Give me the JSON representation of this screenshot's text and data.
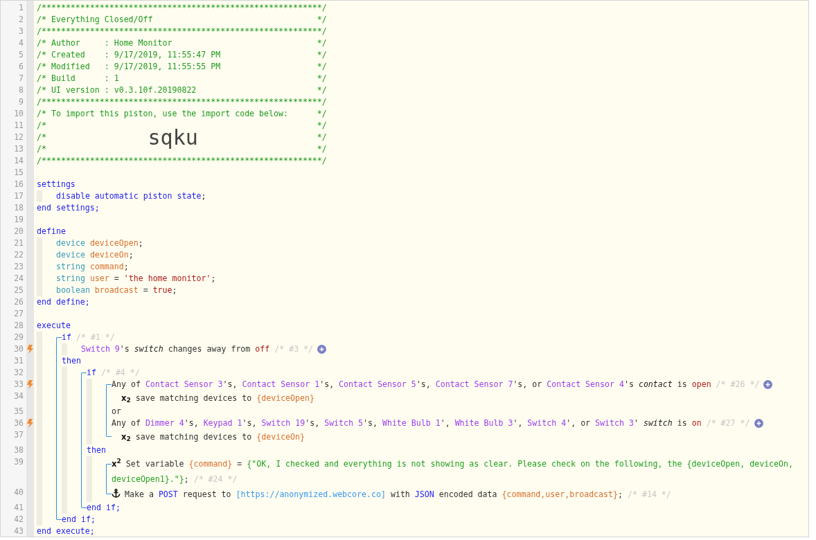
{
  "editor": {
    "code": [
      {
        "kind": "banner",
        "number": "1",
        "text": "/*********************************************************",
        "end": "*/"
      },
      {
        "kind": "banner",
        "number": "2",
        "text": "/* Everything Closed/Off",
        "end": "*/"
      },
      {
        "kind": "banner",
        "number": "3",
        "text": "/*********************************************************",
        "end": "*/"
      },
      {
        "kind": "banner",
        "number": "4",
        "text": "/* Author     : Home Monitor",
        "end": "*/"
      },
      {
        "kind": "banner",
        "number": "5",
        "text": "/* Created    : 9/17/2019, 11:55:47 PM",
        "end": "*/"
      },
      {
        "kind": "banner",
        "number": "6",
        "text": "/* Modified   : 9/17/2019, 11:55:55 PM",
        "end": "*/"
      },
      {
        "kind": "banner",
        "number": "7",
        "text": "/* Build      : 1",
        "end": "*/"
      },
      {
        "kind": "banner",
        "number": "8",
        "text": "/* UI version : v0.3.10f.20190822",
        "end": "*/"
      },
      {
        "kind": "banner",
        "number": "9",
        "text": "/*********************************************************",
        "end": "*/"
      },
      {
        "kind": "banner",
        "number": "10",
        "text": "/* To import this piston, use the import code below:",
        "end": "*/"
      },
      {
        "kind": "banner",
        "number": "11",
        "text": "/*",
        "end": "*/"
      },
      {
        "kind": "banner",
        "number": "12",
        "text": "/*",
        "code": "sqku",
        "end": "*/"
      },
      {
        "kind": "banner",
        "number": "13",
        "text": "/*",
        "end": "*/"
      },
      {
        "kind": "banner",
        "number": "14",
        "text": "/*********************************************************",
        "end": "*/"
      },
      {
        "kind": "blank",
        "number": "15"
      },
      {
        "kind": "line",
        "number": "16",
        "tokens": [
          {
            "kind": "keyword",
            "text": "settings"
          }
        ]
      },
      {
        "kind": "body",
        "children": [
          {
            "kind": "line",
            "number": "17",
            "tokens": [
              {
                "kind": "keyword",
                "text": "disable automatic piston state"
              },
              {
                "kind": "plain",
                "text": ";"
              }
            ]
          }
        ]
      },
      {
        "kind": "line",
        "number": "18",
        "tokens": [
          {
            "kind": "keyword",
            "text": "end settings;"
          }
        ]
      },
      {
        "kind": "blank",
        "number": "19"
      },
      {
        "kind": "line",
        "number": "20",
        "tokens": [
          {
            "kind": "keyword",
            "text": "define"
          }
        ]
      },
      {
        "kind": "body",
        "children": [
          {
            "kind": "line",
            "number": "21",
            "tokens": [
              {
                "kind": "type",
                "text": "device "
              },
              {
                "kind": "variable",
                "text": "deviceOpen"
              },
              {
                "kind": "plain",
                "text": ";"
              }
            ]
          },
          {
            "kind": "line",
            "number": "22",
            "tokens": [
              {
                "kind": "type",
                "text": "device "
              },
              {
                "kind": "variable",
                "text": "deviceOn"
              },
              {
                "kind": "plain",
                "text": ";"
              }
            ]
          },
          {
            "kind": "line",
            "number": "23",
            "tokens": [
              {
                "kind": "type",
                "text": "string "
              },
              {
                "kind": "variable",
                "text": "command"
              },
              {
                "kind": "plain",
                "text": ";"
              }
            ]
          },
          {
            "kind": "line",
            "number": "24",
            "tokens": [
              {
                "kind": "type",
                "text": "string "
              },
              {
                "kind": "variable",
                "text": "user"
              },
              {
                "kind": "plain",
                "text": " = "
              },
              {
                "kind": "literal",
                "text": "'the home monitor'"
              },
              {
                "kind": "plain",
                "text": ";"
              }
            ]
          },
          {
            "kind": "line",
            "number": "25",
            "tokens": [
              {
                "kind": "type",
                "text": "boolean "
              },
              {
                "kind": "variable",
                "text": "broadcast"
              },
              {
                "kind": "plain",
                "text": " = "
              },
              {
                "kind": "literal",
                "text": "true"
              },
              {
                "kind": "plain",
                "text": ";"
              }
            ]
          }
        ]
      },
      {
        "kind": "line",
        "number": "26",
        "tokens": [
          {
            "kind": "keyword",
            "text": "end define;"
          }
        ]
      },
      {
        "kind": "blank",
        "number": "27"
      },
      {
        "kind": "line",
        "number": "28",
        "tokens": [
          {
            "kind": "keyword",
            "text": "execute"
          }
        ]
      },
      {
        "kind": "body",
        "children": [
          {
            "kind": "bracket",
            "children": [
              {
                "kind": "line",
                "number": "29",
                "tokens": [
                  {
                    "kind": "keyword",
                    "text": "if "
                  },
                  {
                    "kind": "note",
                    "text": "/* #1 */"
                  }
                ]
              },
              {
                "kind": "body",
                "children": [
                  {
                    "kind": "condition",
                    "number": "30",
                    "tokens": [
                      {
                        "kind": "device",
                        "text": "Switch 9"
                      },
                      {
                        "kind": "plain",
                        "text": "'s "
                      },
                      {
                        "kind": "attribute",
                        "text": "switch"
                      },
                      {
                        "kind": "plain",
                        "text": " changes away from "
                      },
                      {
                        "kind": "literal",
                        "text": "off"
                      },
                      {
                        "kind": "note",
                        "text": " /* #3 */"
                      }
                    ]
                  }
                ]
              },
              {
                "kind": "line",
                "number": "31",
                "tokens": [
                  {
                    "kind": "keyword",
                    "text": "then"
                  }
                ]
              },
              {
                "kind": "body",
                "children": [
                  {
                    "kind": "bracket",
                    "children": [
                      {
                        "kind": "line",
                        "number": "32",
                        "tokens": [
                          {
                            "kind": "keyword",
                            "text": "if "
                          },
                          {
                            "kind": "note",
                            "text": "/* #4 */"
                          }
                        ]
                      },
                      {
                        "kind": "body",
                        "children": [
                          {
                            "kind": "bracket",
                            "children": [
                              {
                                "kind": "condition",
                                "number": "33",
                                "tokens": [
                                  {
                                    "kind": "plain",
                                    "text": "Any of "
                                  },
                                  {
                                    "kind": "device",
                                    "text": "Contact Sensor 3"
                                  },
                                  {
                                    "kind": "plain",
                                    "text": "'s, "
                                  },
                                  {
                                    "kind": "device",
                                    "text": "Contact Sensor 1"
                                  },
                                  {
                                    "kind": "plain",
                                    "text": "'s, "
                                  },
                                  {
                                    "kind": "device",
                                    "text": "Contact Sensor 5"
                                  },
                                  {
                                    "kind": "plain",
                                    "text": "'s, "
                                  },
                                  {
                                    "kind": "device",
                                    "text": "Contact Sensor 7"
                                  },
                                  {
                                    "kind": "plain",
                                    "text": "'s, or "
                                  },
                                  {
                                    "kind": "device",
                                    "text": "Contact Sensor 4"
                                  },
                                  {
                                    "kind": "plain",
                                    "text": "'s "
                                  },
                                  {
                                    "kind": "attribute",
                                    "text": "contact"
                                  },
                                  {
                                    "kind": "plain",
                                    "text": " is "
                                  },
                                  {
                                    "kind": "literal",
                                    "text": "open"
                                  },
                                  {
                                    "kind": "note",
                                    "text": " /* #26 */"
                                  }
                                ]
                              },
                              {
                                "kind": "option",
                                "number": "34",
                                "tokens": [
                                  {
                                    "kind": "marker",
                                    "text": "x$_{2}$"
                                  },
                                  {
                                    "kind": "plain",
                                    "text": " save matching devices to "
                                  },
                                  {
                                    "kind": "variable",
                                    "text": "{deviceOpen}"
                                  }
                                ]
                              },
                              {
                                "kind": "line",
                                "number": "35",
                                "tokens": [
                                  {
                                    "kind": "plain",
                                    "text": "or"
                                  }
                                ]
                              },
                              {
                                "kind": "condition",
                                "number": "36",
                                "tokens": [
                                  {
                                    "kind": "plain",
                                    "text": "Any of "
                                  },
                                  {
                                    "kind": "device",
                                    "text": "Dimmer 4"
                                  },
                                  {
                                    "kind": "plain",
                                    "text": "'s, "
                                  },
                                  {
                                    "kind": "device",
                                    "text": "Keypad 1"
                                  },
                                  {
                                    "kind": "plain",
                                    "text": "'s, "
                                  },
                                  {
                                    "kind": "device",
                                    "text": "Switch 19"
                                  },
                                  {
                                    "kind": "plain",
                                    "text": "'s, "
                                  },
                                  {
                                    "kind": "device",
                                    "text": "Switch 5"
                                  },
                                  {
                                    "kind": "plain",
                                    "text": "'s, "
                                  },
                                  {
                                    "kind": "device",
                                    "text": "White Bulb 1"
                                  },
                                  {
                                    "kind": "plain",
                                    "text": "', "
                                  },
                                  {
                                    "kind": "device",
                                    "text": "White Bulb 3"
                                  },
                                  {
                                    "kind": "plain",
                                    "text": "', "
                                  },
                                  {
                                    "kind": "device",
                                    "text": "Switch 4"
                                  },
                                  {
                                    "kind": "plain",
                                    "text": "', or "
                                  },
                                  {
                                    "kind": "device",
                                    "text": "Switch 3"
                                  },
                                  {
                                    "kind": "plain",
                                    "text": "' "
                                  },
                                  {
                                    "kind": "attribute",
                                    "text": "switch"
                                  },
                                  {
                                    "kind": "plain",
                                    "text": " is "
                                  },
                                  {
                                    "kind": "literal",
                                    "text": "on"
                                  },
                                  {
                                    "kind": "note",
                                    "text": " /* #27 */"
                                  }
                                ]
                              },
                              {
                                "kind": "option",
                                "number": "37",
                                "tokens": [
                                  {
                                    "kind": "marker",
                                    "text": "x$_{2}$"
                                  },
                                  {
                                    "kind": "plain",
                                    "text": " save matching devices to "
                                  },
                                  {
                                    "kind": "variable",
                                    "text": "{deviceOn}"
                                  }
                                ]
                              }
                            ]
                          }
                        ]
                      },
                      {
                        "kind": "line",
                        "number": "38",
                        "tokens": [
                          {
                            "kind": "keyword",
                            "text": "then"
                          }
                        ]
                      },
                      {
                        "kind": "body",
                        "children": [
                          {
                            "kind": "bracket",
                            "children": [
                              {
                                "kind": "statement",
                                "number": "39",
                                "tokens": [
                                  {
                                    "kind": "marker",
                                    "text": "x$^{2}$"
                                  },
                                  {
                                    "kind": "plain",
                                    "text": " Set variable "
                                  },
                                  {
                                    "kind": "variable",
                                    "text": "{command}"
                                  },
                                  {
                                    "kind": "plain",
                                    "text": " = "
                                  },
                                  {
                                    "kind": "value",
                                    "text": "{\"OK, I checked and everything is not showing as clear. Please check on the following, the {deviceOpen, deviceOn, deviceOpen1}.\"}"
                                  },
                                  {
                                    "kind": "plain",
                                    "text": "; "
                                  },
                                  {
                                    "kind": "note",
                                    "text": "/* #24 */"
                                  }
                                ]
                              },
                              {
                                "kind": "request",
                                "number": "40",
                                "tokens": [
                                  {
                                    "kind": "plain",
                                    "text": "Make a "
                                  },
                                  {
                                    "kind": "keyword",
                                    "text": "POST"
                                  },
                                  {
                                    "kind": "plain",
                                    "text": " request to "
                                  },
                                  {
                                    "kind": "url",
                                    "text": "[https://anonymized.webcore.co]"
                                  },
                                  {
                                    "kind": "plain",
                                    "text": " with "
                                  },
                                  {
                                    "kind": "keyword",
                                    "text": "JSON"
                                  },
                                  {
                                    "kind": "plain",
                                    "text": " encoded data "
                                  },
                                  {
                                    "kind": "variable",
                                    "text": "{command,user,broadcast}"
                                  },
                                  {
                                    "kind": "plain",
                                    "text": "; "
                                  },
                                  {
                                    "kind": "note",
                                    "text": "/* #14 */"
                                  }
                                ]
                              }
                            ]
                          }
                        ]
                      },
                      {
                        "kind": "line",
                        "number": "41",
                        "tokens": [
                          {
                            "kind": "keyword",
                            "text": "end if;"
                          }
                        ]
                      }
                    ]
                  }
                ]
              },
              {
                "kind": "line",
                "number": "42",
                "tokens": [
                  {
                    "kind": "keyword",
                    "text": "end if;"
                  }
                ]
              }
            ]
          }
        ]
      },
      {
        "kind": "line",
        "number": "43",
        "tokens": [
          {
            "kind": "keyword",
            "text": "end execute;"
          }
        ]
      }
    ]
  }
}
